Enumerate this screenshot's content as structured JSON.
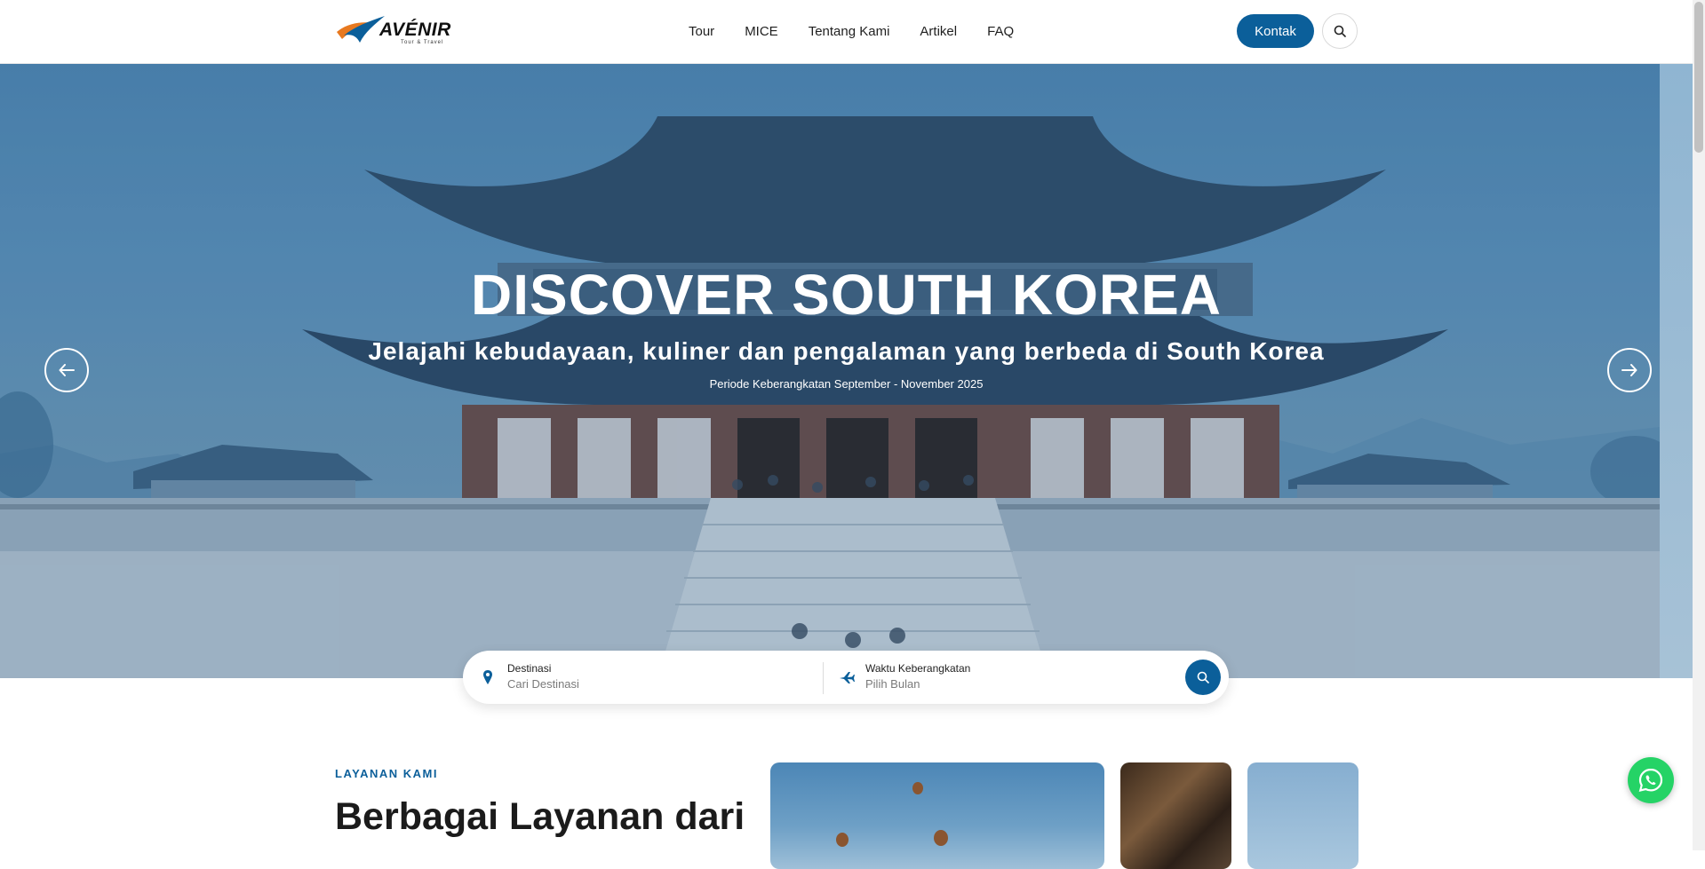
{
  "brand": {
    "name": "AVÉNIR",
    "tagline": "Tour & Travel",
    "primary_color": "#0b5f9a"
  },
  "nav": {
    "items": [
      "Tour",
      "MICE",
      "Tentang Kami",
      "Artikel",
      "FAQ"
    ]
  },
  "header": {
    "cta_label": "Kontak",
    "search_icon": "search-icon"
  },
  "hero": {
    "title": "DISCOVER SOUTH KOREA",
    "subtitle": "Jelajahi kebudayaan, kuliner dan pengalaman yang berbeda di South Korea",
    "period": "Periode Keberangkatan September - November 2025",
    "prev_icon": "arrow-left-icon",
    "next_icon": "arrow-right-icon"
  },
  "search": {
    "destination": {
      "label": "Destinasi",
      "placeholder": "Cari Destinasi",
      "icon": "map-pin-icon"
    },
    "departure": {
      "label": "Waktu Keberangkatan",
      "placeholder": "Pilih Bulan",
      "icon": "plane-icon"
    },
    "submit_icon": "search-icon"
  },
  "services": {
    "eyebrow": "LAYANAN KAMI",
    "title": "Berbagai Layanan dari"
  },
  "whatsapp": {
    "icon": "whatsapp-icon",
    "color": "#25d366"
  }
}
